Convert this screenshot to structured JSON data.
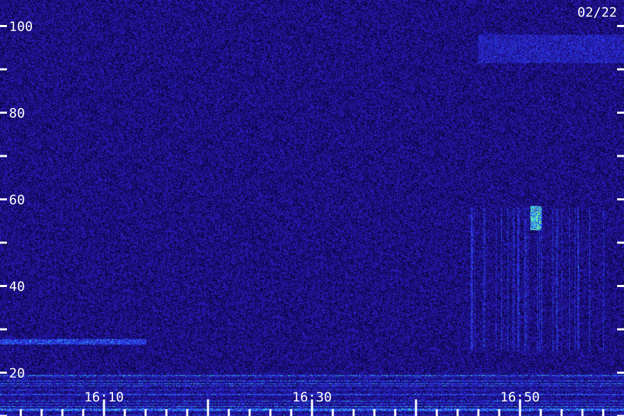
{
  "chart_data": {
    "type": "heatmap",
    "title": "",
    "date_label": "02/22",
    "xlabel": "",
    "ylabel": "",
    "x_range": [
      "16:00",
      "17:00"
    ],
    "x_tick_labels": [
      {
        "time": "16:10",
        "label": "16:10"
      },
      {
        "time": "16:30",
        "label": "16:30"
      },
      {
        "time": "16:50",
        "label": "16:50"
      }
    ],
    "x_minor_tick_minutes": 2,
    "y_range": [
      10,
      106
    ],
    "y_ticks": [
      10,
      20,
      30,
      40,
      50,
      60,
      70,
      80,
      90,
      100
    ],
    "y_tick_labels": [
      {
        "value": 20,
        "label": "20"
      },
      {
        "value": 40,
        "label": "40"
      },
      {
        "value": 60,
        "label": "60"
      },
      {
        "value": 80,
        "label": "80"
      },
      {
        "value": 100,
        "label": "100"
      }
    ],
    "features": [
      {
        "kind": "broadband_noise",
        "time_start": "16:00",
        "time_end": "17:00",
        "y_start": 10,
        "y_end": 20,
        "intensity": 0.8
      },
      {
        "kind": "band",
        "time_start": "16:00",
        "time_end": "16:14",
        "y_start": 26.6,
        "y_end": 27.8,
        "intensity": 0.5
      },
      {
        "kind": "vertical_striations",
        "time_start": "16:45",
        "time_end": "16:58",
        "y_start": 25,
        "y_end": 58,
        "intensity": 0.45
      },
      {
        "kind": "burst",
        "time_start": "16:51",
        "time_end": "16:52",
        "y_start": 53,
        "y_end": 58.5,
        "intensity": 1.0
      },
      {
        "kind": "band",
        "time_start": "16:46",
        "time_end": "17:00",
        "y_start": 91.5,
        "y_end": 98,
        "intensity": 0.25
      }
    ],
    "colors": {
      "background": "#1a0f5a",
      "low": "#2a1890",
      "mid": "#3050ff",
      "high": "#40e0ff",
      "peak": "#a0ff60",
      "axis": "#ffffff"
    }
  }
}
